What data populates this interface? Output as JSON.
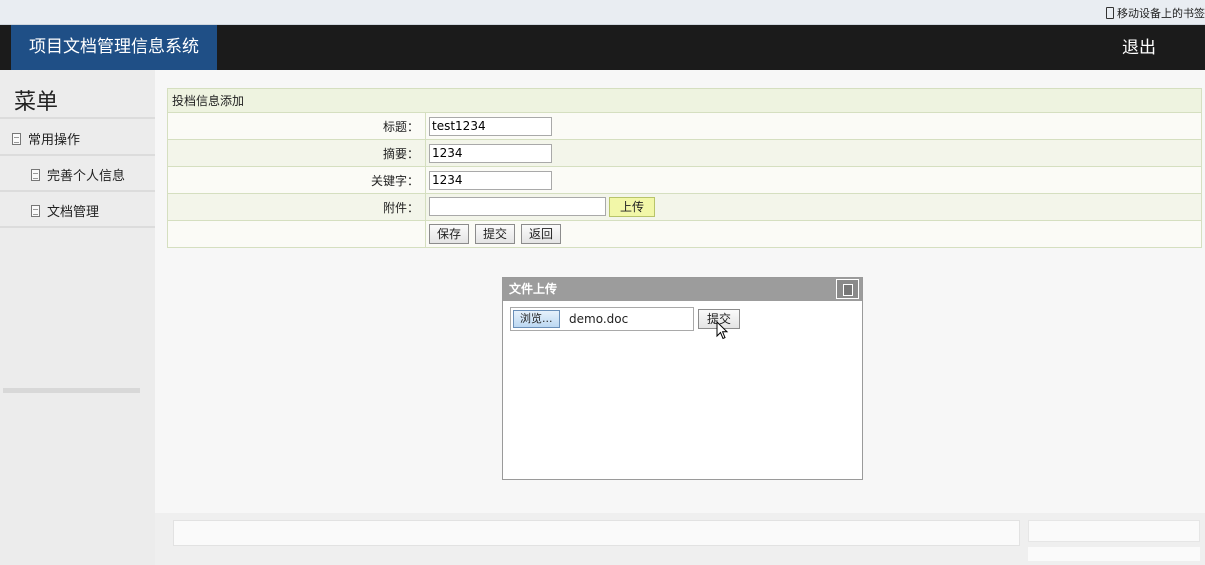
{
  "browser": {
    "bookmark_mobile": "移动设备上的书签"
  },
  "header": {
    "app_title": "项目文档管理信息系统",
    "logout_label": "退出"
  },
  "sidebar": {
    "title": "菜单",
    "items": [
      {
        "label": "常用操作",
        "level": 1
      },
      {
        "label": "完善个人信息",
        "level": 2
      },
      {
        "label": "文档管理",
        "level": 2
      }
    ]
  },
  "form": {
    "section_title": "投档信息添加",
    "fields": [
      {
        "label": "标题：",
        "value": "test1234"
      },
      {
        "label": "摘要：",
        "value": "1234"
      },
      {
        "label": "关键字：",
        "value": "1234"
      }
    ],
    "attachment": {
      "label": "附件：",
      "value": "",
      "upload_label": "上传"
    },
    "buttons": {
      "save": "保存",
      "submit": "提交",
      "back": "返回"
    }
  },
  "upload_dialog": {
    "title": "文件上传",
    "browse_label": "浏览...",
    "file_name": "demo.doc",
    "submit_label": "提交"
  },
  "colors": {
    "header_bg": "#1b1b1b",
    "title_bg": "#1f4f86",
    "upload_btn_bg": "#f2f7a8",
    "form_border": "#d5dfc0"
  }
}
